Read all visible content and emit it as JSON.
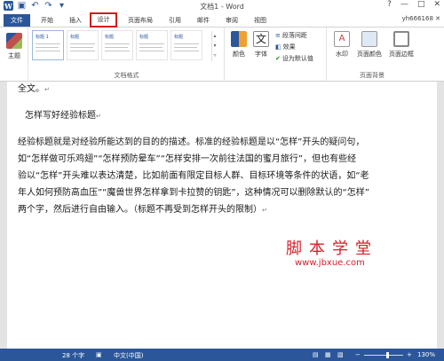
{
  "titlebar": {
    "title": "文档1 - Word",
    "controls": [
      "?",
      "—",
      "□",
      "✕"
    ]
  },
  "tabs": {
    "file": "文件",
    "items": [
      "开始",
      "插入",
      "设计",
      "页面布局",
      "引用",
      "邮件",
      "审阅",
      "视图"
    ],
    "active": "设计",
    "user": "yh666168 ✕"
  },
  "ribbon": {
    "theme_label": "主题",
    "gallery": [
      {
        "title": "标题 1"
      },
      {
        "title": "标题"
      },
      {
        "title": "标题"
      },
      {
        "title": "标题"
      },
      {
        "title": "标题"
      },
      {
        "title": "标题"
      }
    ],
    "group_doc_format": "文档格式",
    "colors_label": "颜色",
    "fonts_label": "字体",
    "para_spacing": "段落间距",
    "effects": "效果",
    "set_default": "设为默认值",
    "watermark_label": "水印",
    "page_color_label": "页面颜色",
    "page_border_label": "页面边框",
    "group_page_bg": "页面背景"
  },
  "document": {
    "line0": "全文。",
    "heading": "怎样写好经验标题",
    "body_lines": [
      "经验标题就是对经验所能达到的目的的描述。标准的经验标题是以“怎样”开头的疑问句，",
      "如“怎样做可乐鸡翅”“怎样预防晕车”“怎样安排一次前往法国的蜜月旅行”，但也有些经",
      "验以“怎样”开头难以表达清楚，比如前面有限定目标人群、目标环境等条件的状语，如“老",
      "年人如何预防高血压”“魔兽世界怎样拿到卡拉赞的钥匙”，这种情况可以删除默认的“怎样”",
      "两个字，然后进行自由输入。（标题不再受到怎样开头的限制）"
    ],
    "para_mark": "↵"
  },
  "watermark": {
    "line1": "脚本学堂",
    "line2": "www.jbxue.com"
  },
  "statusbar": {
    "words": "28 个字",
    "language": "中文(中国)",
    "zoom": "130%",
    "zoom_level": 0.6
  },
  "colors": {
    "accent": "#2b579a",
    "highlight": "#d01c1c",
    "watermark": "#d4202a"
  }
}
